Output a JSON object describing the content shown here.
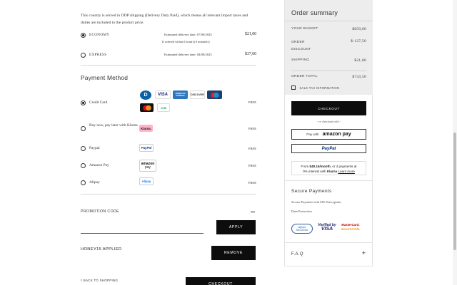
{
  "shipping": {
    "intro": "This country is served in DDP shipping (Delivery Duty Paid), which means all relevant import taxes and duties are included in the product price.",
    "options": [
      {
        "name": "ECONOMY",
        "date": "Estimated delivery date: 07/08/2025",
        "sub": "If ordered within 0 hour(s) 0 minute(s)",
        "price": "$21,00",
        "selected": true
      },
      {
        "name": "EXPRESS",
        "date": "Estimated delivery date: 04/08/2025",
        "sub": "",
        "price": "$37,00",
        "selected": false
      }
    ]
  },
  "payment": {
    "title": "Payment Method",
    "methods": [
      {
        "label": "Credit Card",
        "fee": "FREE",
        "selected": true
      },
      {
        "label": "Buy now, pay later with Klarna",
        "fee": "FREE",
        "selected": false
      },
      {
        "label": "Paypal",
        "fee": "FREE",
        "selected": false
      },
      {
        "label": "Amazon Pay",
        "fee": "FREE",
        "selected": false
      },
      {
        "label": "Alipay",
        "fee": "FREE",
        "selected": false
      }
    ],
    "card_logos": {
      "diners": "D",
      "visa": "VISA",
      "amex": "AMERICAN EXPRESS",
      "discover": "DISCOVER",
      "maestro": "maestro",
      "jcb": "JCB"
    },
    "klarna_badge": "Klarna.",
    "paypal_badge": "PayPal",
    "amazon_badge_top": "amazon",
    "amazon_badge_bottom": "pay",
    "alipay_badge": "Alipay"
  },
  "promo": {
    "label": "PROMOTION CODE",
    "input_value": "",
    "apply_label": "APPLY",
    "applied_text": "HONEY15 APPLIED",
    "remove_label": "REMOVE"
  },
  "footer": {
    "back_label": "BACK TO SHOPPING",
    "checkout_label": "CHECKOUT"
  },
  "summary": {
    "title": "Order summary",
    "rows": [
      {
        "label": "YOUR BASKET",
        "value": "$850,00"
      },
      {
        "label": "ORDER DISCOUNT",
        "value": "$-127,50"
      },
      {
        "label": "SHIPPING",
        "value": "$21,00"
      }
    ],
    "total_label": "ORDER TOTAL",
    "total_value": "$743,50",
    "tax_info": "SALE TAX INFORMATION",
    "checkout_label": "CHECKOUT",
    "or_checkout": "- or checkout with -",
    "amazon_pay_with": "Pay with",
    "amazon_pay_brand": "amazon pay",
    "paypal_brand": "PayPal",
    "klarna_line1_prefix": "From",
    "klarna_amount": "$48.15/month",
    "klarna_line1_suffix": ", or 4 payments at",
    "klarna_line2_prefix": "0% interest with",
    "klarna_brand": "Klarna",
    "klarna_learn": "Learn more"
  },
  "secure": {
    "title": "Secure Payments",
    "line1": "Secure Payment with SSL Encryption",
    "line2": "Data Protection",
    "badges": {
      "digicert_line1": "digicert",
      "digicert_line2": "SECURED",
      "vbv_line1": "Verified by",
      "vbv_line2": "VISA",
      "mc_line1": "MasterCard.",
      "mc_line2": "SecureCode."
    }
  },
  "faq": {
    "title": "F.A.Q",
    "toggle": "+"
  },
  "colors": {
    "black": "#0d0d0d",
    "summary_bg": "#ededed",
    "klarna_pink": "#ffb3c7",
    "paypal_blue": "#003087",
    "amex_blue": "#2e77bc"
  }
}
